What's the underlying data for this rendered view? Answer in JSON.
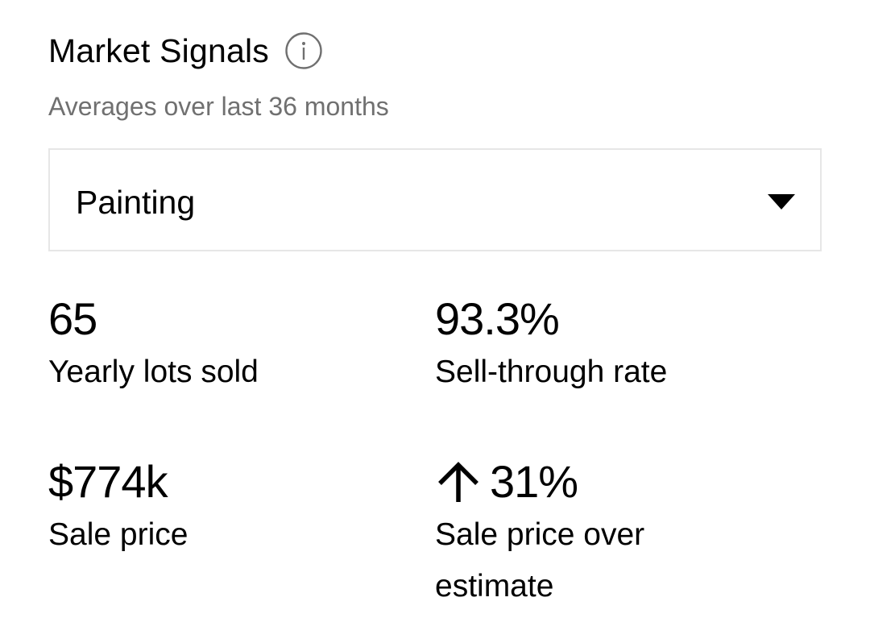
{
  "header": {
    "title": "Market Signals",
    "info_icon": "info-icon"
  },
  "subtitle": "Averages over last 36 months",
  "category_select": {
    "selected": "Painting",
    "icon": "chevron-down-icon"
  },
  "stats": {
    "yearly_lots": {
      "value": "65",
      "label": "Yearly lots sold"
    },
    "sell_through": {
      "value": "93.3%",
      "label": "Sell-through rate"
    },
    "sale_price": {
      "value": "$774k",
      "label": "Sale price"
    },
    "over_estimate": {
      "value": "31%",
      "label": "Sale price over estimate",
      "icon": "arrow-up-icon"
    }
  }
}
